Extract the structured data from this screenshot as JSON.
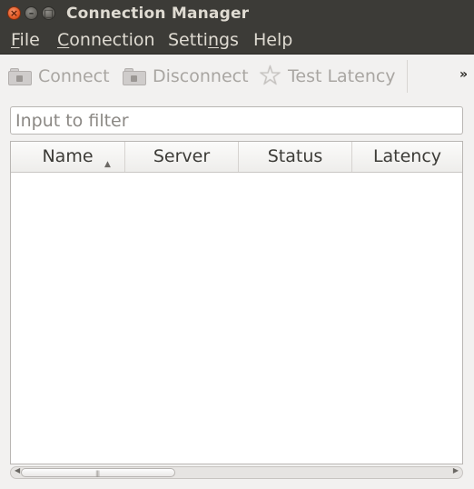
{
  "window": {
    "title": "Connection Manager",
    "controls": {
      "close": "×",
      "minimize": "–",
      "maximize": "□"
    }
  },
  "menubar": {
    "items": [
      {
        "label": "File",
        "mnemonic": "F",
        "rest": "ile"
      },
      {
        "label": "Connection",
        "mnemonic": "C",
        "rest": "onnection"
      },
      {
        "label": "Settings",
        "pre": "Setti",
        "mnemonic": "n",
        "post": "gs"
      },
      {
        "label": "Help"
      }
    ]
  },
  "toolbar": {
    "connect_label": "Connect",
    "disconnect_label": "Disconnect",
    "test_latency_label": "Test Latency",
    "more_label": "»",
    "icons": {
      "connect": "folder-lock-icon",
      "disconnect": "folder-lock-icon",
      "test_latency": "star-icon"
    }
  },
  "filter": {
    "placeholder": "Input to filter",
    "value": ""
  },
  "table": {
    "columns": [
      "Name",
      "Server",
      "Status",
      "Latency"
    ],
    "sort_column": "Name",
    "sort_direction": "ascending",
    "rows": []
  }
}
